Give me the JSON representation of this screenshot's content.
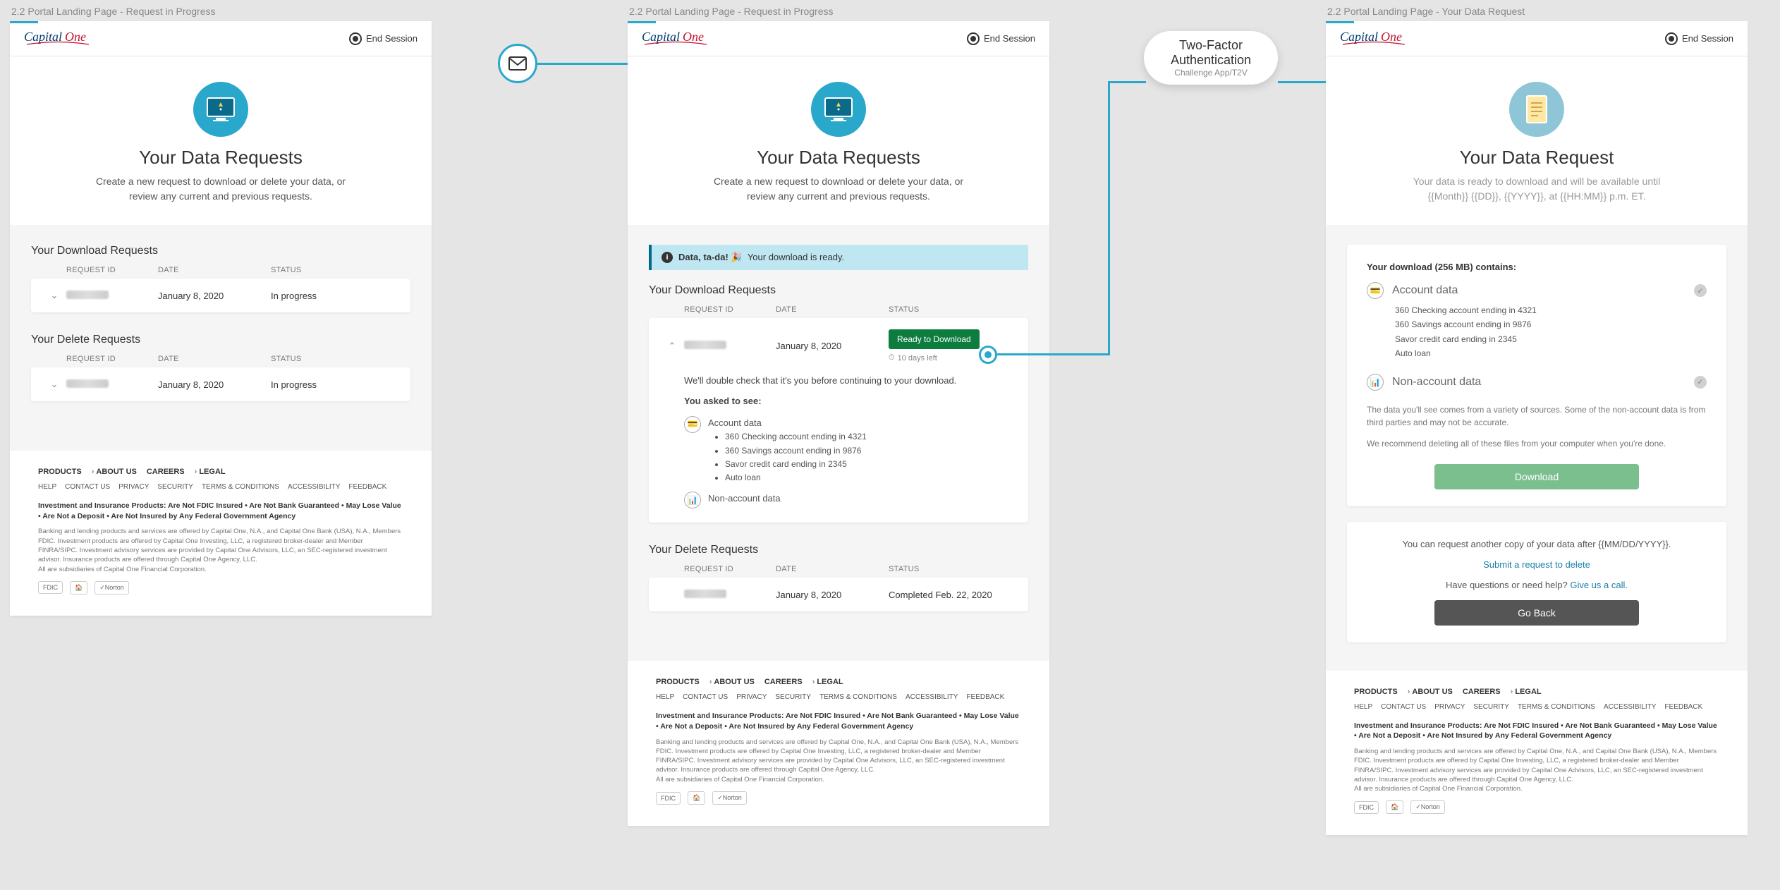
{
  "brand": "Capital One",
  "end_session": "End Session",
  "screens": [
    {
      "label": "2.2 Portal Landing Page - Request in Progress",
      "hero_title": "Your Data Requests",
      "hero_subtitle": "Create a new request to download or delete your data, or review any current and previous requests.",
      "download_title": "Your Download Requests",
      "delete_title": "Your Delete Requests",
      "columns": {
        "id": "REQUEST ID",
        "date": "DATE",
        "status": "STATUS"
      },
      "download_rows": [
        {
          "date": "January 8, 2020",
          "status": "In progress"
        }
      ],
      "delete_rows": [
        {
          "date": "January 8, 2020",
          "status": "In progress"
        }
      ]
    },
    {
      "label": "2.2 Portal Landing Page - Request in Progress",
      "hero_title": "Your Data Requests",
      "hero_subtitle": "Create a new request to download or delete your data, or review any current and previous requests.",
      "banner_bold": "Data, ta-da! 🎉",
      "banner_text": "Your download is ready.",
      "download_title": "Your Download Requests",
      "delete_title": "Your Delete Requests",
      "columns": {
        "id": "REQUEST ID",
        "date": "DATE",
        "status": "STATUS"
      },
      "download_rows": [
        {
          "date": "January 8, 2020",
          "status_btn": "Ready to Download",
          "days_left": "10 days left"
        }
      ],
      "expanded": {
        "intro": "We'll double check that it's you before continuing to your download.",
        "asked": "You asked to see:",
        "account_title": "Account data",
        "accounts": [
          "360 Checking account ending in 4321",
          "360 Savings account ending in 9876",
          "Savor credit card ending in 2345",
          "Auto loan"
        ],
        "nonaccount_title": "Non-account data"
      },
      "delete_rows": [
        {
          "date": "January 8, 2020",
          "status": "Completed Feb. 22, 2020"
        }
      ]
    },
    {
      "label": "2.2 Portal Landing Page - Your Data Request",
      "hero_title": "Your Data Request",
      "hero_subtitle": "Your data is ready to download and will be available until {{Month}} {{DD}}, {{YYYY}}, at {{HH:MM}} p.m. ET.",
      "dl_title": "Your download (256 MB) contains:",
      "account_title": "Account data",
      "accounts": [
        "360 Checking account ending in 4321",
        "360 Savings account ending in 9876",
        "Savor credit card ending in 2345",
        "Auto loan"
      ],
      "nonaccount_title": "Non-account data",
      "note1": "The data you'll see comes from a variety of sources. Some of the non-account data is from third parties and may not be accurate.",
      "note2": "We recommend deleting all of these files from your computer when you're done.",
      "download_btn": "Download",
      "again_text": "You can request another copy of your data after {{MM/DD/YYYY}}.",
      "submit_link": "Submit a request to delete",
      "help_prefix": "Have questions or need help? ",
      "help_link": "Give us a call.",
      "back_btn": "Go Back"
    }
  ],
  "footer": {
    "nav": [
      "PRODUCTS",
      "ABOUT US",
      "CAREERS",
      "LEGAL"
    ],
    "sub": [
      "HELP",
      "CONTACT US",
      "PRIVACY",
      "SECURITY",
      "TERMS & CONDITIONS",
      "ACCESSIBILITY",
      "FEEDBACK"
    ],
    "disclosure": "Investment and Insurance Products: Are Not FDIC Insured • Are Not Bank Guaranteed • May Lose Value • Are Not a Deposit • Are Not Insured by Any Federal Government Agency",
    "fine1": "Banking and lending products and services are offered by Capital One, N.A., and Capital One Bank (USA), N.A., Members FDIC. Investment products are offered by Capital One Investing, LLC, a registered broker-dealer and Member FINRA/SIPC. Investment advisory services are provided by Capital One Advisors, LLC, an SEC-registered investment advisor. Insurance products are offered through Capital One Agency, LLC.",
    "fine2": "All are subsidiaries of Capital One Financial Corporation.",
    "badges": [
      "FDIC",
      "🏠",
      "✓Norton"
    ]
  },
  "flow": {
    "tfa_title": "Two-Factor Authentication",
    "tfa_sub": "Challenge App/T2V"
  }
}
